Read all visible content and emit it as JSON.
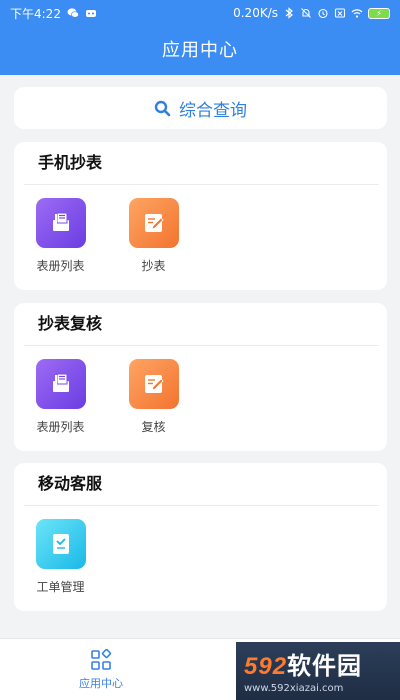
{
  "status": {
    "time": "下午4:22",
    "speed": "0.20K/s",
    "battery": "80"
  },
  "header": {
    "title": "应用中心"
  },
  "search": {
    "label": "综合查询",
    "icon": "search-icon"
  },
  "sections": [
    {
      "title": "手机抄表",
      "items": [
        {
          "label": "表册列表",
          "icon": "ledger-icon",
          "color": "purple"
        },
        {
          "label": "抄表",
          "icon": "edit-icon",
          "color": "orange"
        }
      ]
    },
    {
      "title": "抄表复核",
      "items": [
        {
          "label": "表册列表",
          "icon": "ledger-icon",
          "color": "purple"
        },
        {
          "label": "复核",
          "icon": "edit-icon",
          "color": "orange"
        }
      ]
    },
    {
      "title": "移动客服",
      "items": [
        {
          "label": "工单管理",
          "icon": "workorder-icon",
          "color": "cyan"
        }
      ]
    }
  ],
  "bottom_nav": {
    "active_label": "应用中心",
    "icon": "apps-grid-icon"
  },
  "watermark": {
    "logo_num": "592",
    "logo_text": "软件园",
    "url": "www.592xiazai.com"
  }
}
